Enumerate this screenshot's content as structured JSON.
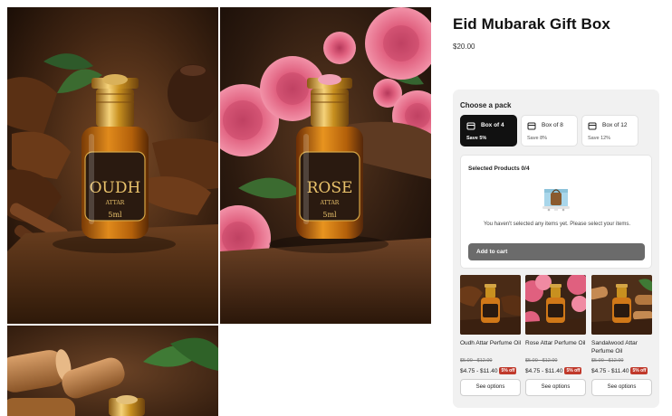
{
  "product": {
    "title": "Eid Mubarak Gift Box",
    "price": "$20.00"
  },
  "gallery": {
    "images": [
      {
        "label": "OUDH",
        "sublabel": "ATTAR",
        "size": "5ml"
      },
      {
        "label": "ROSE",
        "sublabel": "ATTAR",
        "size": "5ml"
      },
      {
        "label": "",
        "sublabel": "",
        "size": ""
      }
    ]
  },
  "bundle": {
    "choose_label": "Choose a pack",
    "packs": [
      {
        "name": "Box of 4",
        "save": "Save 5%",
        "selected": true
      },
      {
        "name": "Box of 8",
        "save": "Save 8%",
        "selected": false
      },
      {
        "name": "Box of 12",
        "save": "Save 12%",
        "selected": false
      }
    ],
    "selected_title": "Selected Products 0/4",
    "empty_message": "You haven't selected any items yet. Please select your items.",
    "add_to_cart": "Add to cart"
  },
  "products": [
    {
      "name": "Oudh Attar Perfume Oil",
      "original_price": "$5.00 - $12.00",
      "price": "$4.75 - $11.40",
      "badge": "5% off",
      "button": "See options"
    },
    {
      "name": "Rose Attar Perfume Oil",
      "original_price": "$5.00 - $12.00",
      "price": "$4.75 - $11.40",
      "badge": "5% off",
      "button": "See options"
    },
    {
      "name": "Sandalwood Attar Perfume Oil",
      "original_price": "$5.00 - $12.00",
      "price": "$4.75 - $11.40",
      "badge": "5% off",
      "button": "See options"
    }
  ],
  "colors": {
    "accent": "#111111",
    "badge": "#c0392b",
    "panel": "#f1f1f1",
    "cart_button": "#6b6b6b"
  }
}
